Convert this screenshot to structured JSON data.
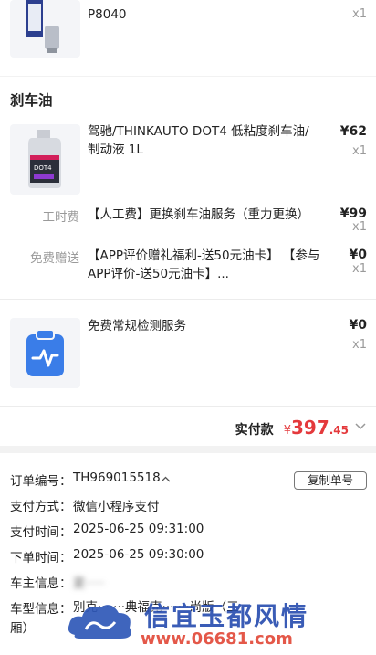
{
  "top_item": {
    "code": "P8040",
    "qty": "x1"
  },
  "brake_section": {
    "title": "刹车油",
    "product": {
      "name_line1": "驾驰/THINKAUTO DOT4  低粘度刹车油/",
      "name_line2": "制动液 1L",
      "price": "¥62",
      "qty": "x1"
    },
    "labor": {
      "label": "工时费",
      "text": "【人工费】更换刹车油服务（重力更换）",
      "price": "¥99",
      "qty": "x1"
    },
    "gift": {
      "label": "免费赠送",
      "text_line1": "【APP评价赠礼福利-送50元油卡】  【参与",
      "text_line2": "APP评价-送50元油卡】...",
      "price": "¥0",
      "qty": "x1"
    }
  },
  "inspection": {
    "name": "免费常规检测服务",
    "price": "¥0",
    "qty": "x1"
  },
  "total": {
    "label": "实付款",
    "currency": "¥",
    "integer": "397",
    "decimal": ".45"
  },
  "order": {
    "number_label": "订单编号：",
    "number_value": "TH969015518",
    "copy_button": "复制单号",
    "payment_label": "支付方式：",
    "payment_value": "微信小程序支付",
    "pay_time_label": "支付时间：",
    "pay_time_value": "2025-06-25 09:31:00",
    "order_time_label": "下单时间：",
    "order_time_value": "2025-06-25 09:30:00",
    "owner_label": "车主信息：",
    "owner_value": "夏·····",
    "car_label": "车型信息：",
    "car_value_line1": "别克·······典福克·······尚版（三",
    "car_value_line2": "厢）"
  },
  "watermark": {
    "text": "信宜玉都风情",
    "url": "www.06681.com"
  },
  "colors": {
    "accent": "#e4393c",
    "icon_blue": "#3a7de8"
  }
}
